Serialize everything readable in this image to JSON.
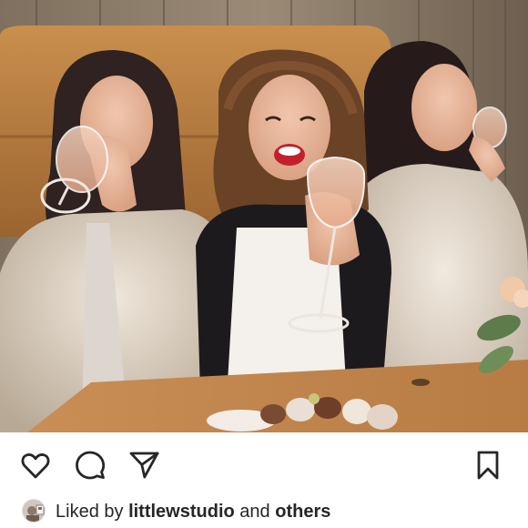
{
  "post": {
    "image": {
      "subject": "post-photo"
    }
  },
  "actions": {
    "like_icon": "heart-outline-icon",
    "comment_icon": "comment-bubble-icon",
    "share_icon": "paper-plane-icon",
    "save_icon": "bookmark-outline-icon"
  },
  "likes": {
    "prefix": "Liked by",
    "first_user": "littlewstudio",
    "connector": "and",
    "others": "others"
  },
  "colors": {
    "text": "#262626",
    "icon": "#262626",
    "background": "#ffffff"
  }
}
